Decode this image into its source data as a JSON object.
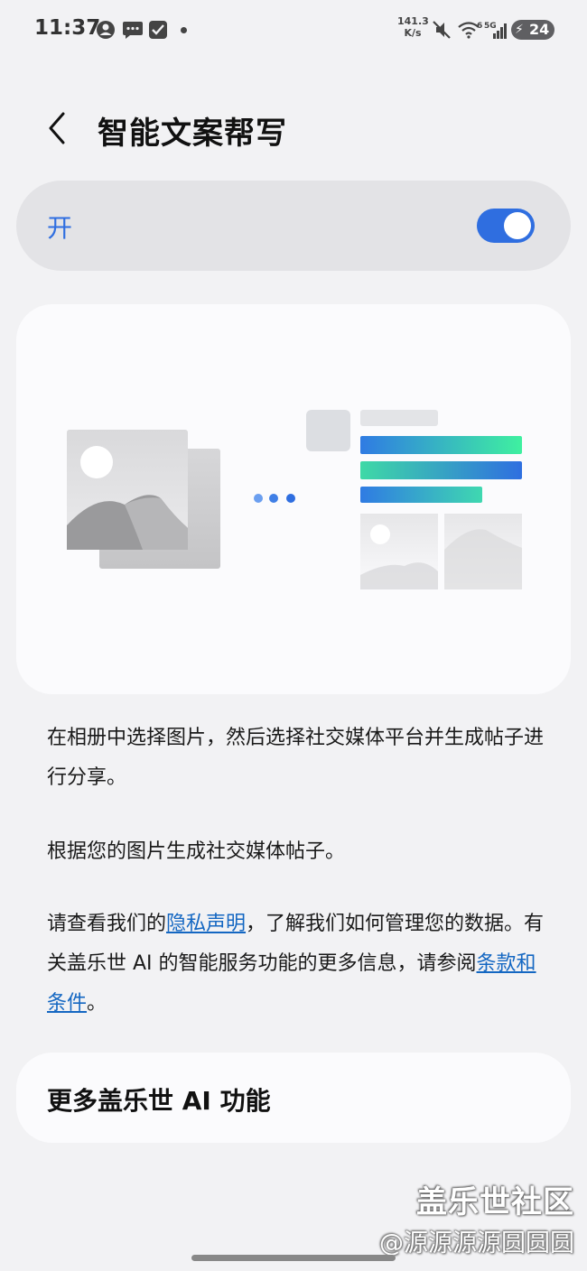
{
  "status_bar": {
    "time": "11:37",
    "net_speed": "141.3",
    "net_speed_unit": "K/s",
    "signal_label": "5G",
    "wifi_label": "6",
    "battery": "24"
  },
  "header": {
    "title": "智能文案帮写"
  },
  "toggle": {
    "label": "开",
    "state": "on",
    "accent": "#2f6ee0"
  },
  "description": {
    "p1": "在相册中选择图片，然后选择社交媒体平台并生成帖子进行分享。",
    "p2": "根据您的图片生成社交媒体帖子。",
    "p3_before": "请查看我们的",
    "p3_link1": "隐私声明",
    "p3_middle": "，了解我们如何管理您的数据。有关盖乐世 AI 的智能服务功能的更多信息，请参阅",
    "p3_link2": "条款和条件",
    "p3_after": "。"
  },
  "more_features": {
    "label": "更多盖乐世 AI 功能"
  },
  "watermark": {
    "line1": "盖乐世社区",
    "line2": "@源源源源圆圆圆"
  }
}
